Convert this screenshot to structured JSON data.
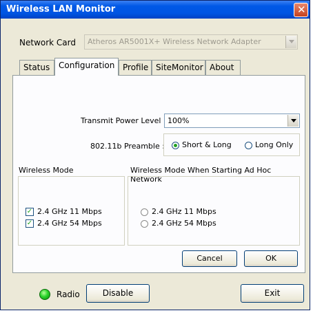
{
  "window": {
    "title": "Wireless LAN Monitor"
  },
  "network_card": {
    "label": "Network Card",
    "value": "Atheros AR5001X+ Wireless Network Adapter"
  },
  "tabs": [
    {
      "label": "Status"
    },
    {
      "label": "Configuration",
      "active": true
    },
    {
      "label": "Profile"
    },
    {
      "label": "SiteMonitor"
    },
    {
      "label": "About"
    }
  ],
  "config": {
    "transmit_power_label": "Transmit Power Level :",
    "transmit_power_value": "100%",
    "preamble_label": "802.11b Preamble :",
    "preamble_options": [
      {
        "label": "Short & Long",
        "selected": true
      },
      {
        "label": "Long Only",
        "selected": false
      }
    ],
    "wireless_mode": {
      "title": "Wireless Mode",
      "options": [
        {
          "label": "2.4 GHz 11 Mbps",
          "checked": true
        },
        {
          "label": "2.4 GHz 54 Mbps",
          "checked": true
        }
      ]
    },
    "adhoc_mode": {
      "title": "Wireless Mode When Starting Ad Hoc Network",
      "options": [
        {
          "label": "2.4 GHz 11 Mbps",
          "selected": false
        },
        {
          "label": "2.4 GHz 54 Mbps",
          "selected": false
        }
      ]
    },
    "cancel_label": "Cancel",
    "ok_label": "OK"
  },
  "footer": {
    "radio_label": "Radio",
    "disable_label": "Disable",
    "exit_label": "Exit",
    "radio_status_color": "#2bd42b"
  }
}
